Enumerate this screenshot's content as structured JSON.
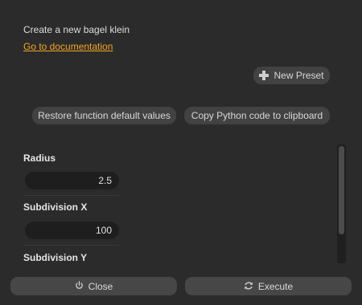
{
  "header": {
    "description": "Create a new bagel klein",
    "doc_link": "Go to documentation"
  },
  "presets": {
    "new_preset_label": "New Preset",
    "new_preset_icon": "plus-icon"
  },
  "actions": {
    "restore_label": "Restore function default values",
    "copy_label": "Copy Python code to clipboard"
  },
  "params": [
    {
      "label": "Radius",
      "value": "2.5"
    },
    {
      "label": "Subdivision X",
      "value": "100"
    },
    {
      "label": "Subdivision Y",
      "value": ""
    }
  ],
  "footer": {
    "close_label": "Close",
    "close_icon": "power-icon",
    "execute_label": "Execute",
    "execute_icon": "refresh-icon"
  },
  "colors": {
    "background": "#2b2b2b",
    "link": "#f5a623",
    "button": "#424242",
    "field": "#1e1e1e"
  }
}
